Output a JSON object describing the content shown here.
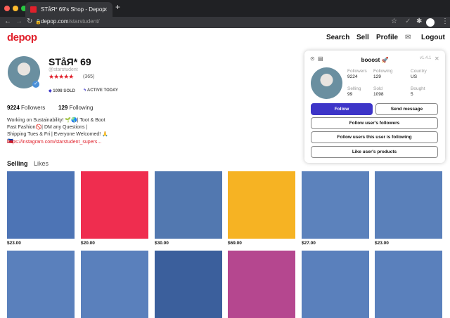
{
  "browser": {
    "tab_title": "STåЯ* 69's Shop - Depop",
    "url_host": "depop.com",
    "url_path": "/starstudent/"
  },
  "header": {
    "logo": "depop",
    "nav": [
      "Search",
      "Sell",
      "Profile",
      "Logout"
    ]
  },
  "profile": {
    "name": "STåЯ* 69",
    "handle": "@starstudent",
    "stars": "★★★★★",
    "reviews": "(365)",
    "sold": "1098 SOLD",
    "active": "ACTIVE TODAY",
    "followers_count": "9224",
    "followers_label": "Followers",
    "following_count": "129",
    "following_label": "Following",
    "bio": [
      "Working on Sustainability! 🌱🌏| Toot & Boot",
      "Fast Fashion🚫| DM any Questions |",
      "Shipping Tues & Fri | Everyone Welcomed! 🙏",
      "🇵🇭"
    ],
    "link": "https://instagram.com/starstudent_supers..."
  },
  "tabs": [
    "Selling",
    "Likes"
  ],
  "items": [
    {
      "price": "$23.00",
      "color": "#4d74b5"
    },
    {
      "price": "$20.00",
      "color": "#ef2d4f"
    },
    {
      "price": "$30.00",
      "color": "#5278b0"
    },
    {
      "price": "$69.00",
      "color": "#f6b323"
    },
    {
      "price": "$27.00",
      "color": "#5c82bc"
    },
    {
      "price": "$23.00",
      "color": "#5a80ba"
    },
    {
      "color": "#5a80bc"
    },
    {
      "color": "#5a80bc"
    },
    {
      "color": "#3b5f9c"
    },
    {
      "color": "#b5478f"
    },
    {
      "color": "#5a80bc"
    },
    {
      "color": "#5a80bc"
    }
  ],
  "boost": {
    "title": "booost 🚀",
    "version": "v1.4.1",
    "stats": [
      {
        "label": "Followers",
        "value": "9224"
      },
      {
        "label": "Following",
        "value": "129"
      },
      {
        "label": "Country",
        "value": "US"
      },
      {
        "label": "Selling",
        "value": "99"
      },
      {
        "label": "Sold",
        "value": "1098"
      },
      {
        "label": "Bought",
        "value": "5"
      }
    ],
    "follow": "Follow",
    "message": "Send message",
    "follow_followers": "Follow user's followers",
    "follow_following": "Follow users this user is following",
    "like_products": "Like user's products",
    "accent": "#3d35c8"
  }
}
